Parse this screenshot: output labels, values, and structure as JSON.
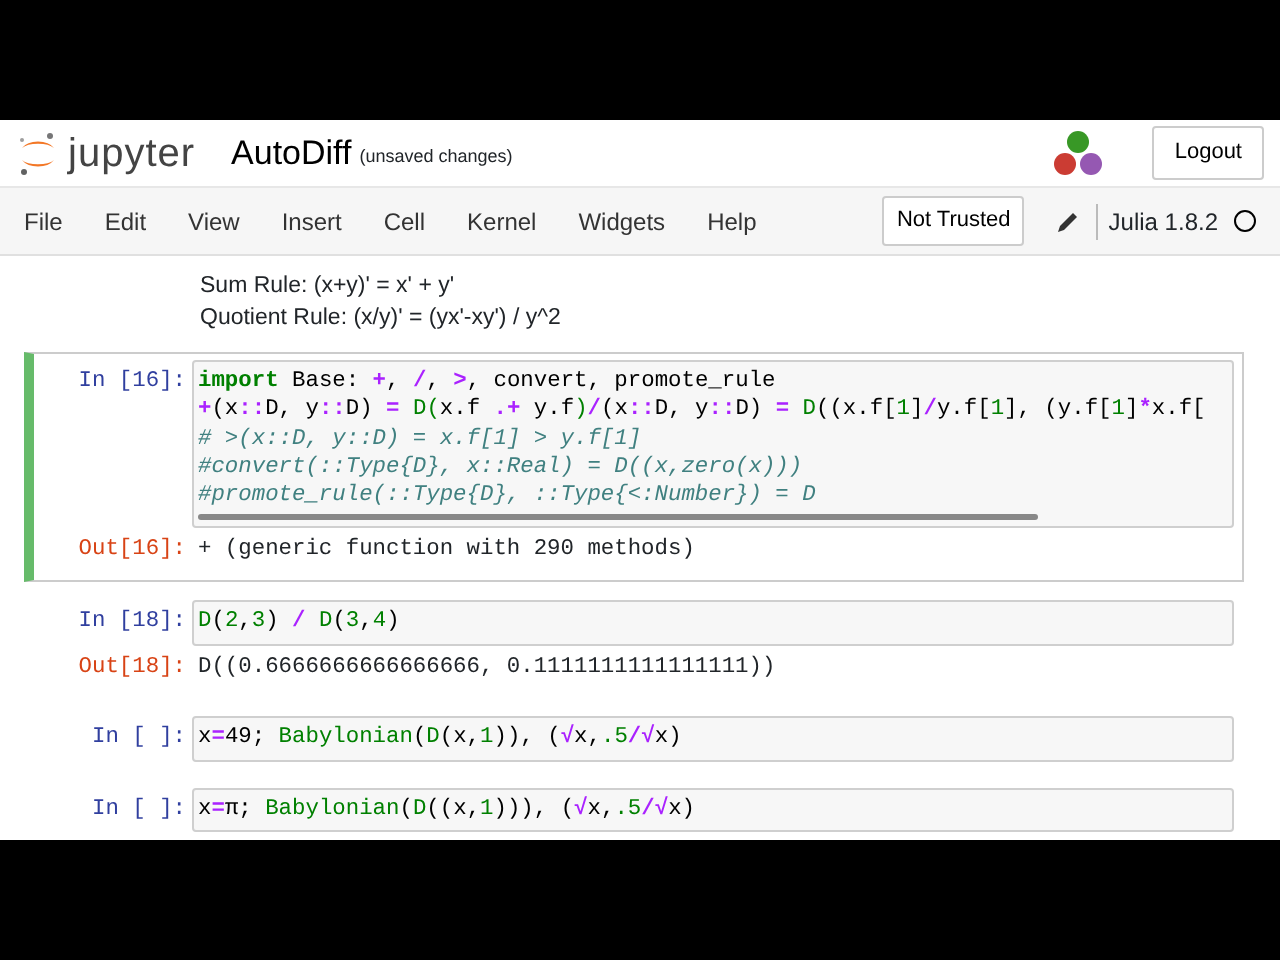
{
  "header": {
    "logo_text": "jupyter",
    "title": "AutoDiff",
    "save_status": "(unsaved changes)",
    "logout": "Logout"
  },
  "menu": [
    "File",
    "Edit",
    "View",
    "Insert",
    "Cell",
    "Kernel",
    "Widgets",
    "Help"
  ],
  "trust": "Not Trusted",
  "kernel": {
    "name": "Julia 1.8.2",
    "busy": false
  },
  "cells": [
    {
      "kind": "markdown",
      "selected": false,
      "lines": [
        "Sum Rule: (x+y)' = x' + y'",
        "Quotient Rule: (x/y)' = (yx'-xy') / y^2"
      ]
    },
    {
      "kind": "code",
      "selected": true,
      "prompt": "In [16]:",
      "lines": [
        [
          {
            "kind": "kw",
            "text": "import"
          },
          {
            "kind": "txt",
            "text": " Base: "
          },
          {
            "kind": "op",
            "text": "+"
          },
          {
            "kind": "txt",
            "text": ", "
          },
          {
            "kind": "op",
            "text": "/"
          },
          {
            "kind": "txt",
            "text": ", "
          },
          {
            "kind": "op",
            "text": ">"
          },
          {
            "kind": "txt",
            "text": ", convert, promote_rule"
          }
        ],
        [
          {
            "kind": "op",
            "text": "+"
          },
          {
            "kind": "txt",
            "text": "(x"
          },
          {
            "kind": "op",
            "text": "::"
          },
          {
            "kind": "txt",
            "text": "D, y"
          },
          {
            "kind": "op",
            "text": "::"
          },
          {
            "kind": "txt",
            "text": "D) "
          },
          {
            "kind": "op",
            "text": "= "
          },
          {
            "kind": "call",
            "text": "D("
          },
          {
            "kind": "txt",
            "text": "x.f "
          },
          {
            "kind": "op",
            "text": ".+"
          },
          {
            "kind": "txt",
            "text": " y.f"
          },
          {
            "kind": "call",
            "text": ")"
          },
          {
            "kind": "op",
            "text": "/"
          },
          {
            "kind": "txt",
            "text": "(x"
          },
          {
            "kind": "op",
            "text": "::"
          },
          {
            "kind": "txt",
            "text": "D, y"
          },
          {
            "kind": "op",
            "text": "::"
          },
          {
            "kind": "txt",
            "text": "D) "
          },
          {
            "kind": "op",
            "text": "= "
          },
          {
            "kind": "call",
            "text": "D"
          },
          {
            "kind": "txt",
            "text": "((x.f["
          },
          {
            "kind": "num",
            "text": "1"
          },
          {
            "kind": "txt",
            "text": "]"
          },
          {
            "kind": "op",
            "text": "/"
          },
          {
            "kind": "txt",
            "text": "y.f["
          },
          {
            "kind": "num",
            "text": "1"
          },
          {
            "kind": "txt",
            "text": "], (y.f["
          },
          {
            "kind": "num",
            "text": "1"
          },
          {
            "kind": "txt",
            "text": "]"
          },
          {
            "kind": "op",
            "text": "*"
          },
          {
            "kind": "txt",
            "text": "x.f["
          }
        ],
        [
          {
            "kind": "cm",
            "text": "# >(x::D, y::D) = x.f[1] > y.f[1]"
          }
        ],
        [
          {
            "kind": "cm",
            "text": "#convert(::Type{D}, x::Real) = D((x,zero(x)))"
          }
        ],
        [
          {
            "kind": "cm",
            "text": "#promote_rule(::Type{D}, ::Type{<:Number}) = D"
          }
        ]
      ],
      "output": {
        "prompt": "Out[16]:",
        "text": "+ (generic function with 290 methods)"
      }
    },
    {
      "kind": "code",
      "selected": false,
      "prompt": "In [18]:",
      "lines": [
        [
          {
            "kind": "call",
            "text": "D"
          },
          {
            "kind": "txt",
            "text": "("
          },
          {
            "kind": "num",
            "text": "2"
          },
          {
            "kind": "txt",
            "text": ","
          },
          {
            "kind": "num",
            "text": "3"
          },
          {
            "kind": "txt",
            "text": ") "
          },
          {
            "kind": "op",
            "text": "/ "
          },
          {
            "kind": "call",
            "text": "D"
          },
          {
            "kind": "txt",
            "text": "("
          },
          {
            "kind": "num",
            "text": "3"
          },
          {
            "kind": "txt",
            "text": ","
          },
          {
            "kind": "num",
            "text": "4"
          },
          {
            "kind": "txt",
            "text": ")"
          }
        ]
      ],
      "output": {
        "prompt": "Out[18]:",
        "text": "D((0.6666666666666666, 0.1111111111111111))"
      }
    },
    {
      "kind": "code",
      "selected": false,
      "prompt": "In [ ]:",
      "lines": [
        [
          {
            "kind": "txt",
            "text": "x"
          },
          {
            "kind": "op",
            "text": "="
          },
          {
            "kind": "txt",
            "text": "49; "
          },
          {
            "kind": "call",
            "text": "Babylonian"
          },
          {
            "kind": "txt",
            "text": "("
          },
          {
            "kind": "call",
            "text": "D"
          },
          {
            "kind": "txt",
            "text": "(x,"
          },
          {
            "kind": "num",
            "text": "1"
          },
          {
            "kind": "txt",
            "text": ")), ("
          },
          {
            "kind": "op",
            "text": "√"
          },
          {
            "kind": "txt",
            "text": "x,"
          },
          {
            "kind": "num",
            "text": ".5"
          },
          {
            "kind": "op",
            "text": "/√"
          },
          {
            "kind": "txt",
            "text": "x)"
          }
        ]
      ]
    },
    {
      "kind": "code",
      "selected": false,
      "prompt": "In [ ]:",
      "lines": [
        [
          {
            "kind": "txt",
            "text": "x"
          },
          {
            "kind": "op",
            "text": "="
          },
          {
            "kind": "txt",
            "text": "π; "
          },
          {
            "kind": "call",
            "text": "Babylonian"
          },
          {
            "kind": "txt",
            "text": "("
          },
          {
            "kind": "call",
            "text": "D"
          },
          {
            "kind": "txt",
            "text": "((x,"
          },
          {
            "kind": "num",
            "text": "1"
          },
          {
            "kind": "txt",
            "text": "))), ("
          },
          {
            "kind": "op",
            "text": "√"
          },
          {
            "kind": "txt",
            "text": "x,"
          },
          {
            "kind": "num",
            "text": ".5"
          },
          {
            "kind": "op",
            "text": "/√"
          },
          {
            "kind": "txt",
            "text": "x)"
          }
        ]
      ]
    }
  ]
}
